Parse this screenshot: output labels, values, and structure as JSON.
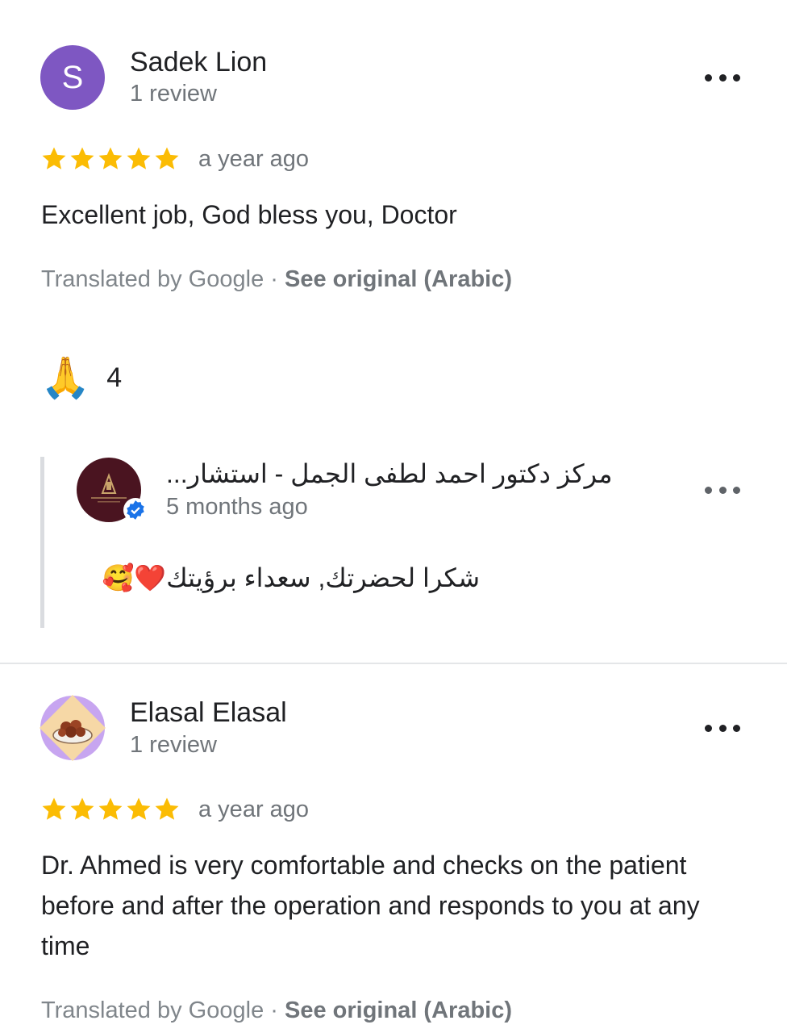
{
  "reviews": [
    {
      "avatar_letter": "S",
      "avatar_color": "#7e57c2",
      "name": "Sadek Lion",
      "review_count": "1 review",
      "rating": 5,
      "time": "a year ago",
      "text": "Excellent job, God bless you, Doctor",
      "translated_label": "Translated by Google",
      "separator": " · ",
      "see_original": "See original (Arabic)",
      "reaction_emoji": "🙏",
      "reaction_count": "4",
      "owner_reply": {
        "owner_name": "مركز دكتور احمد لطفى الجمل - استشار...",
        "time": "5 months ago",
        "text": "شكرا لحضرتك, سعداء برؤيتك❤️🥰",
        "avatar_color": "#4a1420",
        "verified_color": "#1a73e8"
      }
    },
    {
      "name": "Elasal Elasal",
      "review_count": "1 review",
      "rating": 5,
      "time": "a year ago",
      "text": "Dr. Ahmed is very comfortable and checks on the patient before and after the operation and responds to you at any time",
      "translated_label": "Translated by Google",
      "separator": " · ",
      "see_original": "See original (Arabic)"
    }
  ],
  "colors": {
    "star": "#fbbc04",
    "text_primary": "#202124",
    "text_secondary": "#70757a",
    "divider": "#e4e6e8"
  }
}
